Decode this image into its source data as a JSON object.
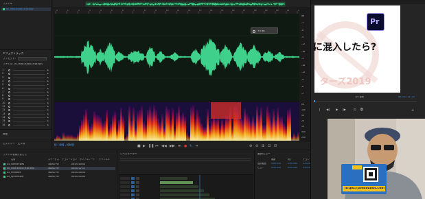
{
  "overview": {
    "file_tab": "00_mod.audio.(M)B.wav"
  },
  "left_panel": {
    "top_label": "ファイル",
    "file_item": "00_mod.audio.(M)B.wav",
    "effects_rack_title": "エフェクトラック",
    "preset_label": "プリセット:",
    "file_label": "ファイル: 00_mod.audio.(M)B.wav",
    "track_numbers": [
      "1",
      "2",
      "3",
      "4",
      "5",
      "6",
      "7",
      "8",
      "9",
      "10",
      "11",
      "12",
      "13",
      "14",
      "15",
      "16"
    ],
    "tabs": {
      "history": "ヒストリー",
      "video": "ビデオ"
    },
    "apply_label": "適用"
  },
  "editor": {
    "hud_value": "+0 dB",
    "db_labels": [
      "dB",
      "-3",
      "-6",
      "-9",
      "-12",
      "-18",
      "-∞",
      "-18",
      "-12",
      "-9",
      "-6",
      "-3"
    ],
    "hz_labels": [
      "Hz",
      "10k",
      "5k",
      "2k",
      "1k",
      "500",
      "200"
    ],
    "timecode": "0:00.000",
    "level_meter_title": "レベルメーター",
    "selection_view_title": "選択/ビュー",
    "selection_headers": [
      "開始",
      "終了",
      "デュレーション"
    ],
    "selection_row_labels": [
      "選択範囲",
      "ビュー"
    ],
    "selection_values": [
      "0:00.000",
      "0:00.000",
      "0:00.000"
    ]
  },
  "files": {
    "title": "ファイルを開きました",
    "columns": [
      "名前",
      "ステータス",
      "デュレーション",
      "サンプルレート",
      "チャンネル"
    ],
    "rows": [
      {
        "name": "04_lavalier.wav",
        "rate": "48000 Hz",
        "dur": "00:00:00:00"
      },
      {
        "name": "00_mod.audio.(M)B.wav",
        "rate": "48000 Hz",
        "dur": "00:00:22:11"
      },
      {
        "name": "04_mixdown",
        "rate": "48000 Hz",
        "dur": "00:00:00:00"
      },
      {
        "name": "04_synthesizer",
        "rate": "48000 Hz",
        "dur": "00:00:00:00"
      }
    ]
  },
  "premiere": {
    "logo_text": "Pr",
    "slide_text": "に混入したら?",
    "slide_subtext": "ターズ2019",
    "fit_label": "1/4 全体",
    "timecode": "00;02;12;25",
    "banner_url": "https://jamsounds.com"
  },
  "colors": {
    "accent": "#3d8ee0",
    "waveform": "#3fd18b",
    "panel_bg": "#232323"
  }
}
